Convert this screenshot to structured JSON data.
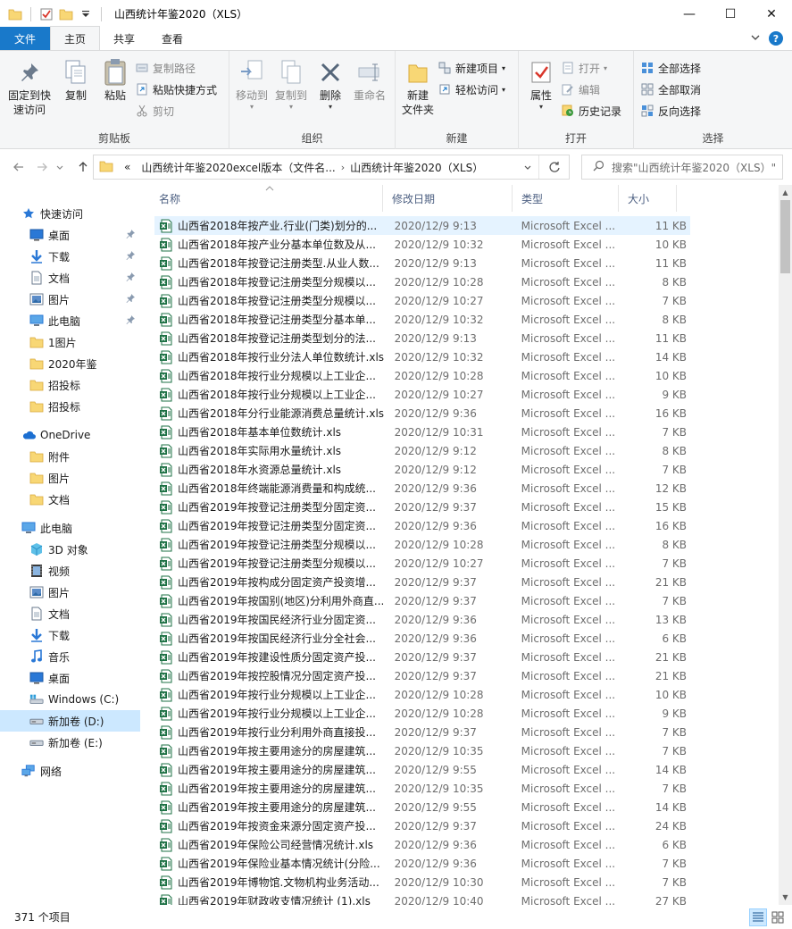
{
  "window": {
    "title": "山西统计年鉴2020（XLS）",
    "controls": {
      "minimize": "—",
      "maximize": "☐",
      "close": "✕"
    }
  },
  "ribbon_tabs": [
    {
      "label": "文件",
      "kind": "file"
    },
    {
      "label": "主页",
      "kind": "active"
    },
    {
      "label": "共享",
      "kind": "normal"
    },
    {
      "label": "查看",
      "kind": "normal"
    }
  ],
  "help_label": "?",
  "ribbon": {
    "clipboard": {
      "label": "剪贴板",
      "pin": "固定到快\n速访问",
      "copy": "复制",
      "paste": "粘贴",
      "copy_path": "复制路径",
      "paste_shortcut": "粘贴快捷方式",
      "cut": "剪切"
    },
    "organize": {
      "label": "组织",
      "move_to": "移动到",
      "copy_to": "复制到",
      "delete": "删除",
      "rename": "重命名"
    },
    "new": {
      "label": "新建",
      "new_folder": "新建\n文件夹",
      "new_item": "新建项目",
      "easy_access": "轻松访问"
    },
    "open": {
      "label": "打开",
      "properties": "属性",
      "open": "打开",
      "edit": "编辑",
      "history": "历史记录"
    },
    "select": {
      "label": "选择",
      "select_all": "全部选择",
      "select_none": "全部取消",
      "invert": "反向选择"
    }
  },
  "address": {
    "prefix": "«",
    "segments": [
      "山西统计年鉴2020excel版本（文件名...",
      "山西统计年鉴2020（XLS）"
    ],
    "search_placeholder": "搜索\"山西统计年鉴2020（XLS）\""
  },
  "nav": [
    {
      "label": "快速访问",
      "icon": "star-icon",
      "indent": 0,
      "group": true
    },
    {
      "label": "桌面",
      "icon": "desktop-icon",
      "indent": 1,
      "pinned": true
    },
    {
      "label": "下载",
      "icon": "download-icon",
      "indent": 1,
      "pinned": true
    },
    {
      "label": "文档",
      "icon": "document-icon",
      "indent": 1,
      "pinned": true
    },
    {
      "label": "图片",
      "icon": "pictures-icon",
      "indent": 1,
      "pinned": true
    },
    {
      "label": "此电脑",
      "icon": "computer-icon",
      "indent": 1,
      "pinned": true
    },
    {
      "label": "1图片",
      "icon": "folder-icon",
      "indent": 1
    },
    {
      "label": "2020年鉴",
      "icon": "folder-icon",
      "indent": 1
    },
    {
      "label": "招投标",
      "icon": "folder-icon",
      "indent": 1
    },
    {
      "label": "招投标",
      "icon": "folder-icon",
      "indent": 1
    },
    {
      "label": "OneDrive",
      "icon": "cloud-icon",
      "indent": 0,
      "group": true
    },
    {
      "label": "附件",
      "icon": "folder-icon",
      "indent": 1
    },
    {
      "label": "图片",
      "icon": "folder-icon",
      "indent": 1
    },
    {
      "label": "文档",
      "icon": "folder-icon",
      "indent": 1
    },
    {
      "label": "此电脑",
      "icon": "computer-icon",
      "indent": 0,
      "group": true
    },
    {
      "label": "3D 对象",
      "icon": "cube-icon",
      "indent": 1
    },
    {
      "label": "视频",
      "icon": "video-icon",
      "indent": 1
    },
    {
      "label": "图片",
      "icon": "pictures-icon",
      "indent": 1
    },
    {
      "label": "文档",
      "icon": "document-icon",
      "indent": 1
    },
    {
      "label": "下载",
      "icon": "download-icon",
      "indent": 1
    },
    {
      "label": "音乐",
      "icon": "music-icon",
      "indent": 1
    },
    {
      "label": "桌面",
      "icon": "desktop-icon",
      "indent": 1
    },
    {
      "label": "Windows (C:)",
      "icon": "windows-drive-icon",
      "indent": 1
    },
    {
      "label": "新加卷 (D:)",
      "icon": "drive-icon",
      "indent": 1,
      "selected": true
    },
    {
      "label": "新加卷 (E:)",
      "icon": "drive-icon",
      "indent": 1
    },
    {
      "label": "网络",
      "icon": "network-icon",
      "indent": 0,
      "group": true
    }
  ],
  "columns": {
    "name": "名称",
    "date": "修改日期",
    "type": "类型",
    "size": "大小"
  },
  "files": [
    {
      "name": "山西省2018年按产业.行业(门类)划分的...",
      "date": "2020/12/9 9:13",
      "type": "Microsoft Excel ...",
      "size": "11 KB"
    },
    {
      "name": "山西省2018年按产业分基本单位数及从...",
      "date": "2020/12/9 10:32",
      "type": "Microsoft Excel ...",
      "size": "10 KB"
    },
    {
      "name": "山西省2018年按登记注册类型.从业人数...",
      "date": "2020/12/9 9:13",
      "type": "Microsoft Excel ...",
      "size": "11 KB"
    },
    {
      "name": "山西省2018年按登记注册类型分规模以...",
      "date": "2020/12/9 10:28",
      "type": "Microsoft Excel ...",
      "size": "8 KB"
    },
    {
      "name": "山西省2018年按登记注册类型分规模以...",
      "date": "2020/12/9 10:27",
      "type": "Microsoft Excel ...",
      "size": "7 KB"
    },
    {
      "name": "山西省2018年按登记注册类型分基本单...",
      "date": "2020/12/9 10:32",
      "type": "Microsoft Excel ...",
      "size": "8 KB"
    },
    {
      "name": "山西省2018年按登记注册类型划分的法...",
      "date": "2020/12/9 9:13",
      "type": "Microsoft Excel ...",
      "size": "11 KB"
    },
    {
      "name": "山西省2018年按行业分法人单位数统计.xls",
      "date": "2020/12/9 10:32",
      "type": "Microsoft Excel ...",
      "size": "14 KB"
    },
    {
      "name": "山西省2018年按行业分规模以上工业企...",
      "date": "2020/12/9 10:28",
      "type": "Microsoft Excel ...",
      "size": "10 KB"
    },
    {
      "name": "山西省2018年按行业分规模以上工业企...",
      "date": "2020/12/9 10:27",
      "type": "Microsoft Excel ...",
      "size": "9 KB"
    },
    {
      "name": "山西省2018年分行业能源消费总量统计.xls",
      "date": "2020/12/9 9:36",
      "type": "Microsoft Excel ...",
      "size": "16 KB"
    },
    {
      "name": "山西省2018年基本单位数统计.xls",
      "date": "2020/12/9 10:31",
      "type": "Microsoft Excel ...",
      "size": "7 KB"
    },
    {
      "name": "山西省2018年实际用水量统计.xls",
      "date": "2020/12/9 9:12",
      "type": "Microsoft Excel ...",
      "size": "8 KB"
    },
    {
      "name": "山西省2018年水资源总量统计.xls",
      "date": "2020/12/9 9:12",
      "type": "Microsoft Excel ...",
      "size": "7 KB"
    },
    {
      "name": "山西省2018年终端能源消费量和构成统...",
      "date": "2020/12/9 9:36",
      "type": "Microsoft Excel ...",
      "size": "12 KB"
    },
    {
      "name": "山西省2019年按登记注册类型分固定资...",
      "date": "2020/12/9 9:37",
      "type": "Microsoft Excel ...",
      "size": "15 KB"
    },
    {
      "name": "山西省2019年按登记注册类型分固定资...",
      "date": "2020/12/9 9:36",
      "type": "Microsoft Excel ...",
      "size": "16 KB"
    },
    {
      "name": "山西省2019年按登记注册类型分规模以...",
      "date": "2020/12/9 10:28",
      "type": "Microsoft Excel ...",
      "size": "8 KB"
    },
    {
      "name": "山西省2019年按登记注册类型分规模以...",
      "date": "2020/12/9 10:27",
      "type": "Microsoft Excel ...",
      "size": "7 KB"
    },
    {
      "name": "山西省2019年按构成分固定资产投资增...",
      "date": "2020/12/9 9:37",
      "type": "Microsoft Excel ...",
      "size": "21 KB"
    },
    {
      "name": "山西省2019年按国别(地区)分利用外商直...",
      "date": "2020/12/9 9:37",
      "type": "Microsoft Excel ...",
      "size": "7 KB"
    },
    {
      "name": "山西省2019年按国民经济行业分固定资...",
      "date": "2020/12/9 9:36",
      "type": "Microsoft Excel ...",
      "size": "13 KB"
    },
    {
      "name": "山西省2019年按国民经济行业分全社会...",
      "date": "2020/12/9 9:36",
      "type": "Microsoft Excel ...",
      "size": "6 KB"
    },
    {
      "name": "山西省2019年按建设性质分固定资产投...",
      "date": "2020/12/9 9:37",
      "type": "Microsoft Excel ...",
      "size": "21 KB"
    },
    {
      "name": "山西省2019年按控股情况分固定资产投...",
      "date": "2020/12/9 9:37",
      "type": "Microsoft Excel ...",
      "size": "21 KB"
    },
    {
      "name": "山西省2019年按行业分规模以上工业企...",
      "date": "2020/12/9 10:28",
      "type": "Microsoft Excel ...",
      "size": "10 KB"
    },
    {
      "name": "山西省2019年按行业分规模以上工业企...",
      "date": "2020/12/9 10:28",
      "type": "Microsoft Excel ...",
      "size": "9 KB"
    },
    {
      "name": "山西省2019年按行业分利用外商直接投...",
      "date": "2020/12/9 9:37",
      "type": "Microsoft Excel ...",
      "size": "7 KB"
    },
    {
      "name": "山西省2019年按主要用途分的房屋建筑...",
      "date": "2020/12/9 10:35",
      "type": "Microsoft Excel ...",
      "size": "7 KB"
    },
    {
      "name": "山西省2019年按主要用途分的房屋建筑...",
      "date": "2020/12/9 9:55",
      "type": "Microsoft Excel ...",
      "size": "14 KB"
    },
    {
      "name": "山西省2019年按主要用途分的房屋建筑...",
      "date": "2020/12/9 10:35",
      "type": "Microsoft Excel ...",
      "size": "7 KB"
    },
    {
      "name": "山西省2019年按主要用途分的房屋建筑...",
      "date": "2020/12/9 9:55",
      "type": "Microsoft Excel ...",
      "size": "14 KB"
    },
    {
      "name": "山西省2019年按资金来源分固定资产投...",
      "date": "2020/12/9 9:37",
      "type": "Microsoft Excel ...",
      "size": "24 KB"
    },
    {
      "name": "山西省2019年保险公司经营情况统计.xls",
      "date": "2020/12/9 9:36",
      "type": "Microsoft Excel ...",
      "size": "6 KB"
    },
    {
      "name": "山西省2019年保险业基本情况统计(分险...",
      "date": "2020/12/9 9:36",
      "type": "Microsoft Excel ...",
      "size": "7 KB"
    },
    {
      "name": "山西省2019年博物馆.文物机构业务活动...",
      "date": "2020/12/9 10:30",
      "type": "Microsoft Excel ...",
      "size": "7 KB"
    },
    {
      "name": "山西省2019年财政收支情况统计 (1).xls",
      "date": "2020/12/9 10:40",
      "type": "Microsoft Excel ...",
      "size": "27 KB"
    }
  ],
  "status": {
    "count": "371 个项目"
  },
  "colors": {
    "accent": "#1979ca",
    "selection": "#cce8ff",
    "hover": "#e5f3ff",
    "excel_green": "#1e7145"
  }
}
